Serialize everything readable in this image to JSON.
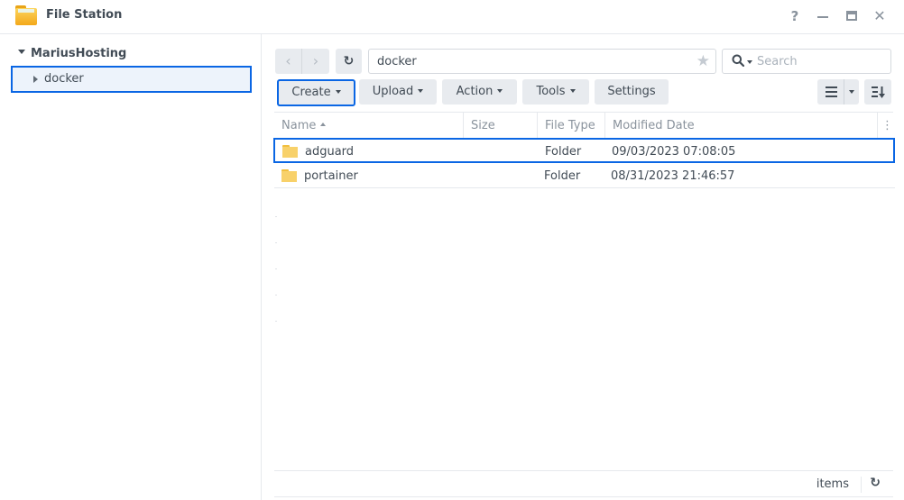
{
  "window": {
    "title": "File Station",
    "app_icon": "folder-icon",
    "controls": {
      "help": "?",
      "minimize": "minimize-icon",
      "maximize": "maximize-icon",
      "close": "✕"
    }
  },
  "sidebar": {
    "root_label": "MariusHosting",
    "items": [
      {
        "label": "docker",
        "selected": true
      }
    ]
  },
  "toolbar": {
    "back_icon": "‹",
    "forward_icon": "›",
    "refresh_icon": "↻",
    "path": "docker",
    "favorite_icon": "★",
    "search_placeholder": "Search",
    "buttons": {
      "create": "Create",
      "upload": "Upload",
      "action": "Action",
      "tools": "Tools",
      "settings": "Settings"
    }
  },
  "grid": {
    "columns": [
      "Name",
      "Size",
      "File Type",
      "Modified Date"
    ],
    "more_icon": "⋮",
    "rows": [
      {
        "name": "adguard",
        "size": "",
        "type": "Folder",
        "modified": "09/03/2023 07:08:05",
        "selected": true
      },
      {
        "name": "portainer",
        "size": "",
        "type": "Folder",
        "modified": "08/31/2023 21:46:57",
        "selected": false
      }
    ]
  },
  "footer": {
    "items_label": "items",
    "refresh_icon": "↻"
  },
  "colors": {
    "accent": "#0a66e4",
    "button_bg": "#e8ebef",
    "text": "#414b55",
    "muted_text": "#8a939d",
    "folder": "#f8d16a"
  }
}
